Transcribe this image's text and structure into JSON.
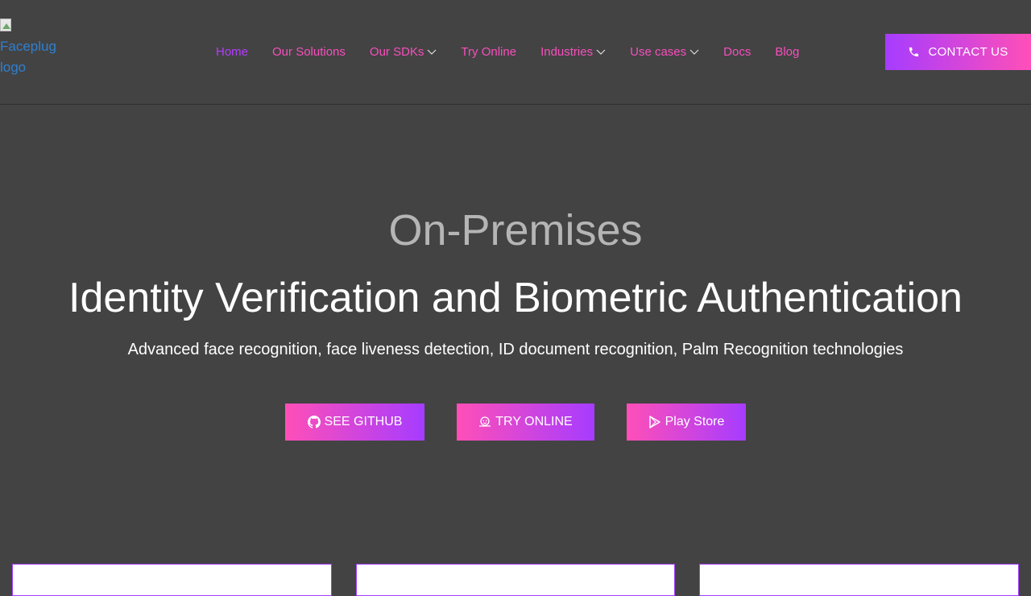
{
  "header": {
    "logo_alt_line1": "Faceplug",
    "logo_alt_line2": "logo",
    "nav": [
      {
        "label": "Home",
        "active": true
      },
      {
        "label": "Our Solutions"
      },
      {
        "label": "Our SDKs",
        "dropdown": true
      },
      {
        "label": "Try Online"
      },
      {
        "label": "Industries",
        "dropdown": true
      },
      {
        "label": "Use cases",
        "dropdown": true
      },
      {
        "label": "Docs"
      },
      {
        "label": "Blog"
      }
    ],
    "contact_label": "CONTACT US"
  },
  "hero": {
    "subtitle": "On-Premises",
    "title": "Identity Verification and Biometric Authentication",
    "description": "Advanced face recognition, face liveness detection, ID document recognition, Palm Recognition technologies",
    "buttons": {
      "github": "SEE GITHUB",
      "try_online": "TRY ONLINE",
      "play_store": "Play Store"
    }
  },
  "colors": {
    "background": "#434343",
    "accent_pink": "#ff4fb8",
    "accent_purple": "#a63cff",
    "nav_link": "#f74fbd"
  },
  "icons": {
    "contact": "phone-icon",
    "github": "github-icon",
    "try_online": "face-scan-icon",
    "play_store": "play-store-icon",
    "dropdown": "chevron-down-icon"
  }
}
